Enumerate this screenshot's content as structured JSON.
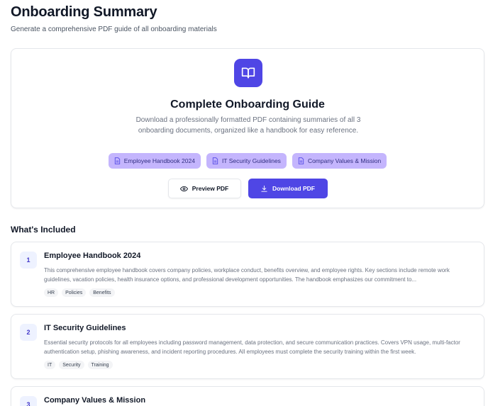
{
  "header": {
    "title": "Onboarding Summary",
    "subtitle": "Generate a comprehensive PDF guide of all onboarding materials"
  },
  "hero": {
    "icon": "book-open-icon",
    "title": "Complete Onboarding Guide",
    "description": "Download a professionally formatted PDF containing summaries of all 3 onboarding documents, organized like a handbook for easy reference.",
    "chips": [
      {
        "label": "Employee Handbook 2024",
        "icon": "file-icon"
      },
      {
        "label": "IT Security Guidelines",
        "icon": "file-icon"
      },
      {
        "label": "Company Values & Mission",
        "icon": "file-icon"
      }
    ],
    "preview_label": "Preview PDF",
    "download_label": "Download PDF"
  },
  "included": {
    "title": "What's Included",
    "documents": [
      {
        "number": "1",
        "title": "Employee Handbook 2024",
        "description": "This comprehensive employee handbook covers company policies, workplace conduct, benefits overview, and employee rights. Key sections include remote work guidelines, vacation policies, health insurance options, and professional development opportunities. The handbook emphasizes our commitment to...",
        "tags": [
          "HR",
          "Policies",
          "Benefits"
        ]
      },
      {
        "number": "2",
        "title": "IT Security Guidelines",
        "description": "Essential security protocols for all employees including password management, data protection, and secure communication practices. Covers VPN usage, multi-factor authentication setup, phishing awareness, and incident reporting procedures. All employees must complete the security training within the first week.",
        "tags": [
          "IT",
          "Security",
          "Training"
        ]
      },
      {
        "number": "3",
        "title": "Company Values & Mission"
      }
    ]
  },
  "colors": {
    "accent": "#4f46e5",
    "chip_bg": "#c4b5fd",
    "badge_bg": "#eef2ff"
  }
}
